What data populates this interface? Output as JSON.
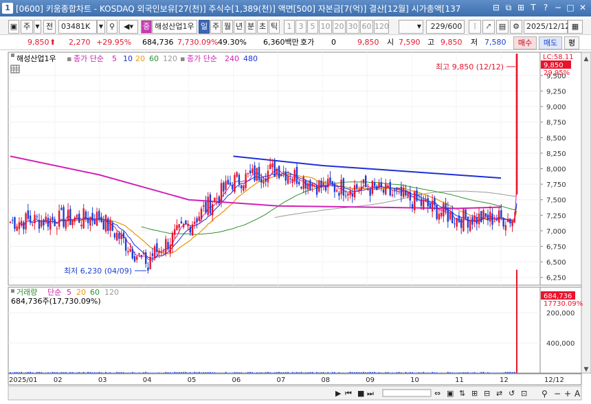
{
  "window": {
    "number": "1",
    "title": "[0600] 키움종합차트 - KOSDAQ 외국인보유[27(천)] 주식수[1,389(천)] 액면[500] 자본금[7(억)] 결산[12월] 시가총액[137",
    "controls": [
      "⊟",
      "⧉",
      "⊞",
      "T",
      "?",
      "−",
      "□",
      "✕"
    ]
  },
  "toolbar": {
    "mode_btn": "주",
    "prev_btn": "전",
    "code": "03481K",
    "stock_name": "해성산업1우",
    "prefix_badge": "중",
    "period_buttons": [
      {
        "label": "일",
        "selected": true
      },
      {
        "label": "주",
        "selected": false
      },
      {
        "label": "월",
        "selected": false
      },
      {
        "label": "년",
        "selected": false
      },
      {
        "label": "분",
        "selected": false
      },
      {
        "label": "초",
        "selected": false
      },
      {
        "label": "틱",
        "selected": false
      }
    ],
    "interval_buttons": [
      "1",
      "3",
      "5",
      "10",
      "20",
      "30",
      "60",
      "120"
    ],
    "count": "229/600",
    "date": "2025/12/12"
  },
  "quote": {
    "price": "9,850",
    "arrow": "⬆",
    "change": "2,270",
    "change_pct": "+29.95%",
    "volume": "684,736",
    "volume_pct": "7,730.09%",
    "turnover_pct": "49.30%",
    "trade_value": "6,360백만",
    "hoga_label": "호가",
    "hoga_value": "0",
    "hoga_price": "9,850",
    "open_label": "시",
    "open": "7,590",
    "high_label": "고",
    "high": "9,850",
    "low_label": "저",
    "low": "7,580",
    "buy_btn": "매수",
    "sell_btn": "매도",
    "eval_btn": "평"
  },
  "legend": {
    "stock": "해성산업1우",
    "ma_short": {
      "label": "종가 단순",
      "periods": [
        "5",
        "10",
        "20",
        "60",
        "120"
      ]
    },
    "ma_long": {
      "label": "종가 단순",
      "periods": [
        "240",
        "480"
      ]
    },
    "colors": {
      "5": "#cc1fa8",
      "10": "#1a2fd8",
      "20": "#e89a12",
      "60": "#2f8f2f",
      "120": "#999999",
      "240": "#d21fb7",
      "480": "#1d2fd8"
    }
  },
  "volume_legend": {
    "label": "거래량",
    "ma_label": "단순",
    "periods": [
      "5",
      "20",
      "60",
      "120"
    ],
    "current": "684,736주(17,730.09%)"
  },
  "annotations": {
    "high": "최고 9,850 (12/12)",
    "low": "최저 6,230 (04/09)"
  },
  "right_axis": {
    "top_label": "LC:58.11",
    "price_tag": "9,850",
    "price_tag_pct": "29.95%",
    "ticks": [
      "9,500",
      "9,250",
      "9,000",
      "8,750",
      "8,500",
      "8,250",
      "8,000",
      "7,750",
      "7,500",
      "7,250",
      "7,000",
      "6,750",
      "6,500",
      "6,250"
    ],
    "vol_tag": "684,736",
    "vol_tag_pct": "17730.09%",
    "vol_ticks": [
      "400,000",
      "200,000"
    ]
  },
  "x_axis": {
    "labels": [
      "2025/01",
      "02",
      "03",
      "04",
      "05",
      "06",
      "07",
      "08",
      "09",
      "10",
      "11",
      "12"
    ],
    "last_label": "12/12"
  },
  "chart_data": {
    "type": "candlestick",
    "stock": "해성산업1우",
    "period": "daily",
    "x_range": [
      "2025/01",
      "2025/12/12"
    ],
    "ylim": [
      6125,
      9875
    ],
    "ohlc_last": {
      "open": 7590,
      "high": 9850,
      "low": 7580,
      "close": 9850
    },
    "high_point": {
      "date": "12/12",
      "value": 9850
    },
    "low_point": {
      "date": "04/09",
      "value": 6230
    },
    "monthly_approx_close": [
      {
        "month": "2025/01",
        "value": 7150
      },
      {
        "month": "02",
        "value": 7180
      },
      {
        "month": "03",
        "value": 7220
      },
      {
        "month": "04",
        "value": 6500
      },
      {
        "month": "05",
        "value": 7100
      },
      {
        "month": "06",
        "value": 7800
      },
      {
        "month": "07",
        "value": 8000
      },
      {
        "month": "08",
        "value": 7700
      },
      {
        "month": "09",
        "value": 7700
      },
      {
        "month": "10",
        "value": 7500
      },
      {
        "month": "11",
        "value": 7200
      },
      {
        "month": "12",
        "value": 9850
      }
    ],
    "ma_240_approx": [
      {
        "month": "2025/01",
        "value": 8200
      },
      {
        "month": "03",
        "value": 7900
      },
      {
        "month": "05",
        "value": 7500
      },
      {
        "month": "07",
        "value": 7400
      },
      {
        "month": "09",
        "value": 7380
      },
      {
        "month": "11",
        "value": 7360
      },
      {
        "month": "12",
        "value": 7380
      }
    ],
    "ma_480_approx": [
      {
        "month": "06",
        "value": 8200
      },
      {
        "month": "08",
        "value": 8050
      },
      {
        "month": "10",
        "value": 7950
      },
      {
        "month": "12",
        "value": 7850
      }
    ],
    "volume": {
      "last": 684736,
      "ylim": [
        0,
        560000
      ],
      "ticks": [
        200000,
        400000
      ]
    }
  }
}
